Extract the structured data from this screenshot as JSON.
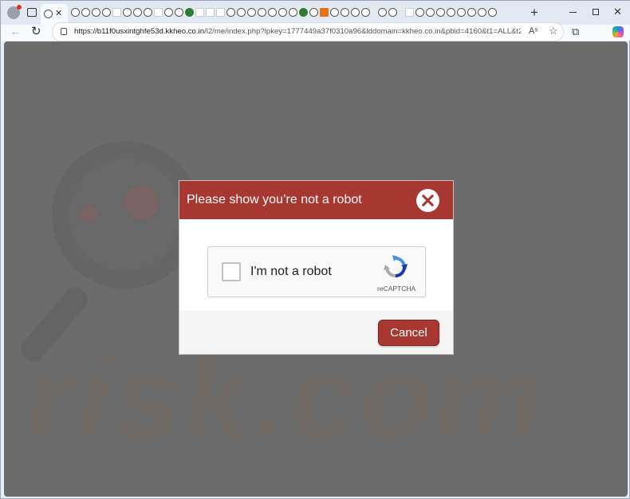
{
  "browser": {
    "url_host": "https://b11f0usxintghfe53d.kkheo.co.in",
    "url_path": "/l2/me/index.php?lpkey=1777449a37f0310a96&lddomain=kkheo.co.in&pbid=4160&t1=ALL&t2=me&t3=18&...",
    "icons": {
      "profile": "profile-icon",
      "tab_actions": "tab-actions-icon",
      "new_tab": "plus-icon",
      "back": "back-arrow-icon",
      "reload": "reload-icon",
      "lock": "lock-icon",
      "read_aloud": "read-aloud-icon",
      "favorite": "star-icon",
      "favorites_bar": "favorites-icon",
      "copilot": "copilot-icon"
    },
    "new_tab_glyph": "+",
    "tab_close_glyph": "✕",
    "window_close_glyph": "✕",
    "back_glyph": "←",
    "reload_glyph": "↻",
    "read_aloud_glyph": "Aˢ",
    "favorite_glyph": "☆",
    "favorites_bar_glyph": "⧉"
  },
  "dialog": {
    "title": "Please show you’re not a robot",
    "captcha_label": "I'm not a robot",
    "captcha_brand": "reCAPTCHA",
    "cancel_label": "Cancel"
  },
  "watermark": {
    "text": "risk.com"
  },
  "colors": {
    "dialog_accent": "#a83732",
    "page_overlay": "#6c6c6c"
  }
}
